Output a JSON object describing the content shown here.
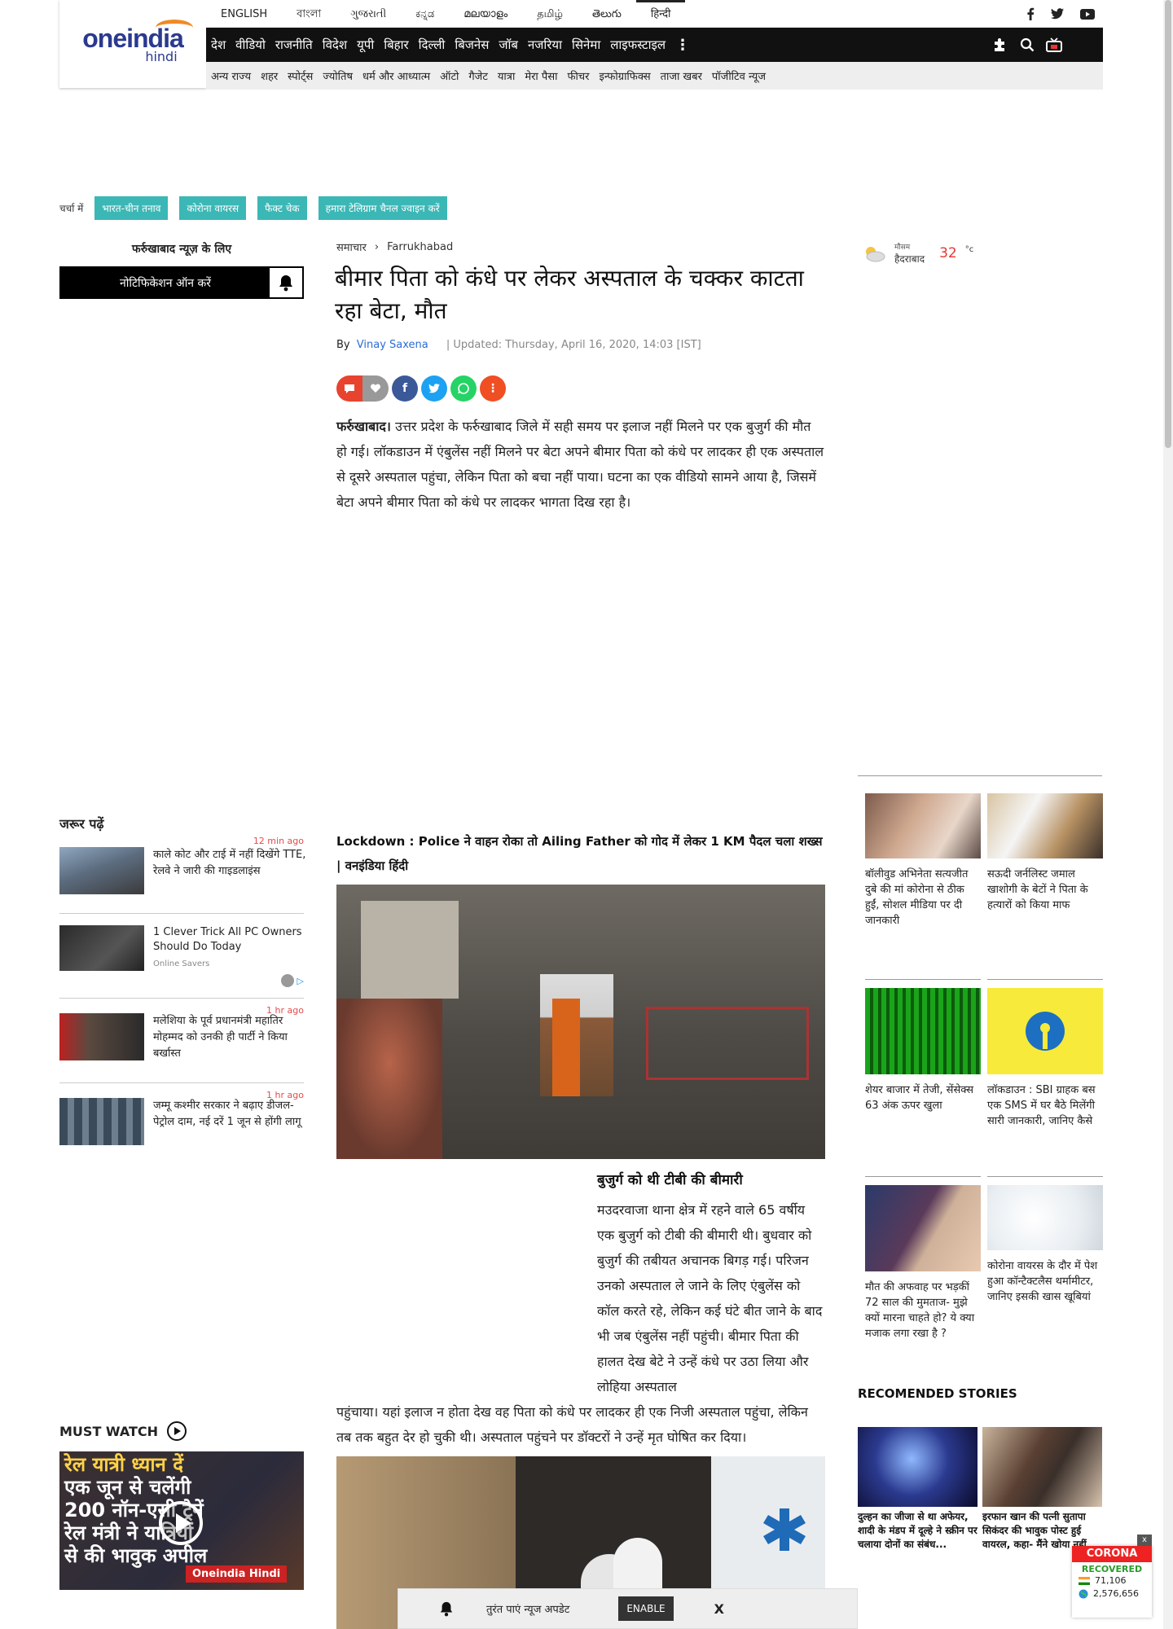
{
  "header": {
    "logo_main": "oneindia",
    "logo_sub": "hindi",
    "languages": [
      "ENGLISH",
      "বাংলা",
      "ગુજરાતી",
      "ಕನ್ನಡ",
      "മലയാളം",
      "தமிழ்",
      "తెలుగు",
      "हिन्दी"
    ],
    "active_language": "हिन्दी",
    "social_icons": [
      "facebook-icon",
      "twitter-icon",
      "youtube-icon"
    ],
    "nav": [
      "देश",
      "वीडियो",
      "राजनीति",
      "विदेश",
      "यूपी",
      "बिहार",
      "दिल्ली",
      "बिजनेस",
      "जॉब",
      "नजरिया",
      "सिनेमा",
      "लाइफस्टाइल"
    ],
    "subnav": [
      "अन्य राज्य",
      "शहर",
      "स्पोर्ट्स",
      "ज्योतिष",
      "धर्म और आध्यात्म",
      "ऑटो",
      "गैजेट",
      "यात्रा",
      "मेरा पैसा",
      "फीचर",
      "इन्फोग्राफिक्स",
      "ताजा खबर",
      "पॉजीटिव न्यूज"
    ]
  },
  "trending": {
    "label": "चर्चा में",
    "chips": [
      "भारत-चीन तनाव",
      "कोरोना वायरस",
      "फैक्ट चेक",
      "हमारा टेलिग्राम चैनल ज्वाइन करें"
    ]
  },
  "sidebar_left": {
    "notify_title": "फर्रुखाबाद न्यूज़ के लिए",
    "notify_button": "नोटिफिकेशन ऑन करें",
    "must_read_title": "जरूर पढ़ें",
    "must_read": [
      {
        "text": "काले कोट और टाई में नहीं दिखेंगे TTE, रेलवे ने जारी की गाइडलाइंस",
        "time": "12 min ago"
      },
      {
        "text": "1 Clever Trick All PC Owners Should Do Today",
        "sponsor": "Online Savers",
        "time": ""
      },
      {
        "text": "मलेशिया के पूर्व प्रधानमंत्री महातिर मोहम्मद को उनकी ही पार्टी ने किया बर्खास्त",
        "time": "1 hr ago"
      },
      {
        "text": "जम्मू कश्मीर सरकार ने बढ़ाए डीजल-पेट्रोल दाम, नई दरें 1 जून से होंगी लागू",
        "time": "1 hr ago"
      }
    ],
    "must_watch_title": "MUST WATCH",
    "video_caption_lines": [
      "रेल यात्री ध्यान दें",
      "एक जून से चलेंगी",
      "200 नॉन-एसी ट्रेनें",
      "रेल मंत्री ने यात्रियों",
      "से की भावुक अपील"
    ],
    "video_brand": "Oneindia Hindi"
  },
  "article": {
    "breadcrumb": [
      "समाचार",
      "Farrukhabad"
    ],
    "headline": "बीमार पिता को कंधे पर लेकर अस्पताल के चक्कर काटता रहा बेटा, मौत",
    "by_label": "By",
    "author": "Vinay Saxena",
    "updated": "| Updated: Thursday, April 16, 2020, 14:03 [IST]",
    "intro_bold": "फर्रुखाबाद।",
    "intro": " उत्तर प्रदेश के फर्रुखाबाद जिले में सही समय पर इलाज नहीं मिलने पर एक बुजुर्ग की मौत हो गई। लॉकडाउन में एंबुलेंस नहीं मिलने पर बेटा अपने बीमार पिता को कंधे पर लादकर ही एक अस्पताल से दूसरे अस्पताल पहुंचा, लेकिन पिता को बचा नहीं पाया। घटना का एक वीडियो सामने आया है, जिसमें बेटा अपने बीमार पिता को कंधे पर लादकर भागता दिख रहा है।",
    "video_title": "Lockdown : Police ने वाहन रोका तो Ailing Father को गोद में लेकर 1 KM पैदल चला शख्स | वनइंडिया हिंदी",
    "subhead": "बुजुर्ग को थी टीबी की बीमारी",
    "para2": "मउदरवाजा थाना क्षेत्र में रहने वाले 65 वर्षीय एक बुजुर्ग को टीबी की बीमारी थी। बुधवार को बुजुर्ग की तबीयत अचानक बिगड़ गई। परिजन उनको अस्पताल ले जाने के लिए एंबुलेंस को कॉल करते रहे, लेकिन कई घंटे बीत जाने के बाद भी जब एंबुलेंस नहीं पहुंची। बीमार पिता की हालत देख बेटे ने उन्हें कंधे पर उठा लिया और लोहिया अस्पताल",
    "para3": "पहुंचाया। यहां इलाज न होता देख वह पिता को कंधे पर लादकर ही एक निजी अस्पताल पहुंचा, लेकिन तब तक बहुत देर हो चुकी थी। अस्पताल पहुंचने पर डॉक्टरों ने उन्हें मृत घोषित कर दिया।"
  },
  "sidebar_right": {
    "weather_label": "मौसम",
    "weather_city": "हैदराबाद",
    "weather_temp": "32",
    "weather_unit": "°c",
    "cards": [
      {
        "text": "बॉलीवुड अभिनेता सत्यजीत दुबे की मां कोरोना से ठीक हुईं, सोशल मीडिया पर दी जानकारी"
      },
      {
        "text": "सऊदी जर्नलिस्ट जमाल खाशोगी के बेटों ने पिता के हत्यारों को किया माफ"
      },
      {
        "text": "शेयर बाजार में तेजी, सेंसेक्स 63 अंक ऊपर खुला"
      },
      {
        "text": "लॉकडाउन : SBI ग्राहक बस एक SMS में घर बैठे मिलेंगी सारी जानकारी, जानिए कैसे"
      },
      {
        "text": "मौत की अफवाह पर भड़कीं 72 साल की मुमताज- मुझे क्यों मारना चाहते हो? ये क्या मजाक लगा रखा है ?"
      },
      {
        "text": "कोरोना वायरस के दौर में पेश हुआ कॉन्टैक्टलैस थर्मामीटर, जानिए इसकी खास खूबियां"
      }
    ],
    "recommended_title": "RECOMENDED STORIES",
    "recommended": [
      {
        "text": "दुल्हन का जीजा से था अफेयर, शादी के मंडप में दूल्हे ने स्क्रीन पर चलाया दोनों का संबंध..."
      },
      {
        "text": "इरफान खान की पत्नी सुतापा सिकंदर की भावुक पोस्ट हुई वायरल, कहा- मैंने खोया नहीं"
      }
    ]
  },
  "corona_widget": {
    "title": "CORONA",
    "status": "RECOVERED",
    "india_count": "71,106",
    "world_count": "2,576,656",
    "close": "x"
  },
  "push_bar": {
    "text": "तुरंत पाएं न्यूज अपडेट",
    "enable": "ENABLE",
    "close": "X"
  },
  "colors": {
    "accent": "#3bb7b6",
    "nav_bg": "#111111",
    "brand": "#2b3a8f",
    "red": "#e33333"
  }
}
